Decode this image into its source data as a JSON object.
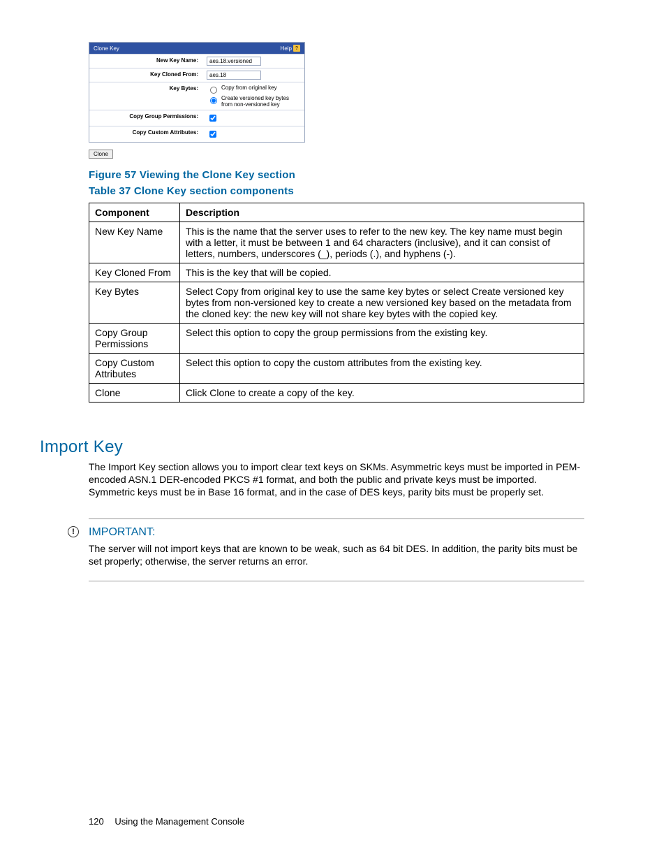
{
  "panel": {
    "title": "Clone Key",
    "help": "Help",
    "rows": {
      "new_key_name_label": "New Key Name:",
      "new_key_name_value": "aes.18.versioned",
      "cloned_from_label": "Key Cloned From:",
      "cloned_from_value": "aes.18",
      "key_bytes_label": "Key Bytes:",
      "kb_opt1": "Copy from original key",
      "kb_opt2": "Create versioned key bytes from non-versioned key",
      "copy_group_label": "Copy Group Permissions:",
      "copy_custom_label": "Copy Custom Attributes:"
    },
    "clone_btn": "Clone"
  },
  "fig_caption": "Figure 57 Viewing the Clone Key section",
  "table_caption": "Table 37 Clone Key section components",
  "table": {
    "h1": "Component",
    "h2": "Description",
    "rows": [
      {
        "c": "New Key Name",
        "d": "This is the name that the server uses to refer to the new key. The key name must begin with a letter, it must be between 1 and 64 characters (inclusive), and it can consist of letters, numbers, underscores (_), periods (.), and hyphens (-)."
      },
      {
        "c": "Key Cloned From",
        "d": "This is the key that will be copied."
      },
      {
        "c": "Key Bytes",
        "d": "Select Copy from original key to use the same key bytes or select Create versioned key bytes from non-versioned key to create a new versioned key based on the metadata from the cloned key: the new key will not share key bytes with the copied key."
      },
      {
        "c": "Copy Group Permissions",
        "d": "Select this option to copy the group permissions from the existing key."
      },
      {
        "c": "Copy Custom Attributes",
        "d": "Select this option to copy the custom attributes from the existing key."
      },
      {
        "c": "Clone",
        "d": "Click Clone to create a copy of the key."
      }
    ]
  },
  "section_heading": "Import Key",
  "section_body": "The Import Key section allows you to import clear text keys on SKMs. Asymmetric keys must be imported in PEM-encoded ASN.1 DER-encoded PKCS #1 format, and both the public and private keys must be imported. Symmetric keys must be in Base 16 format, and in the case of DES keys, parity bits must be properly set.",
  "note": {
    "label": "IMPORTANT:",
    "text": "The server will not import keys that are known to be weak, such as 64 bit DES. In addition, the parity bits must be set properly; otherwise, the server returns an error."
  },
  "footer": {
    "page": "120",
    "title": "Using the Management Console"
  }
}
